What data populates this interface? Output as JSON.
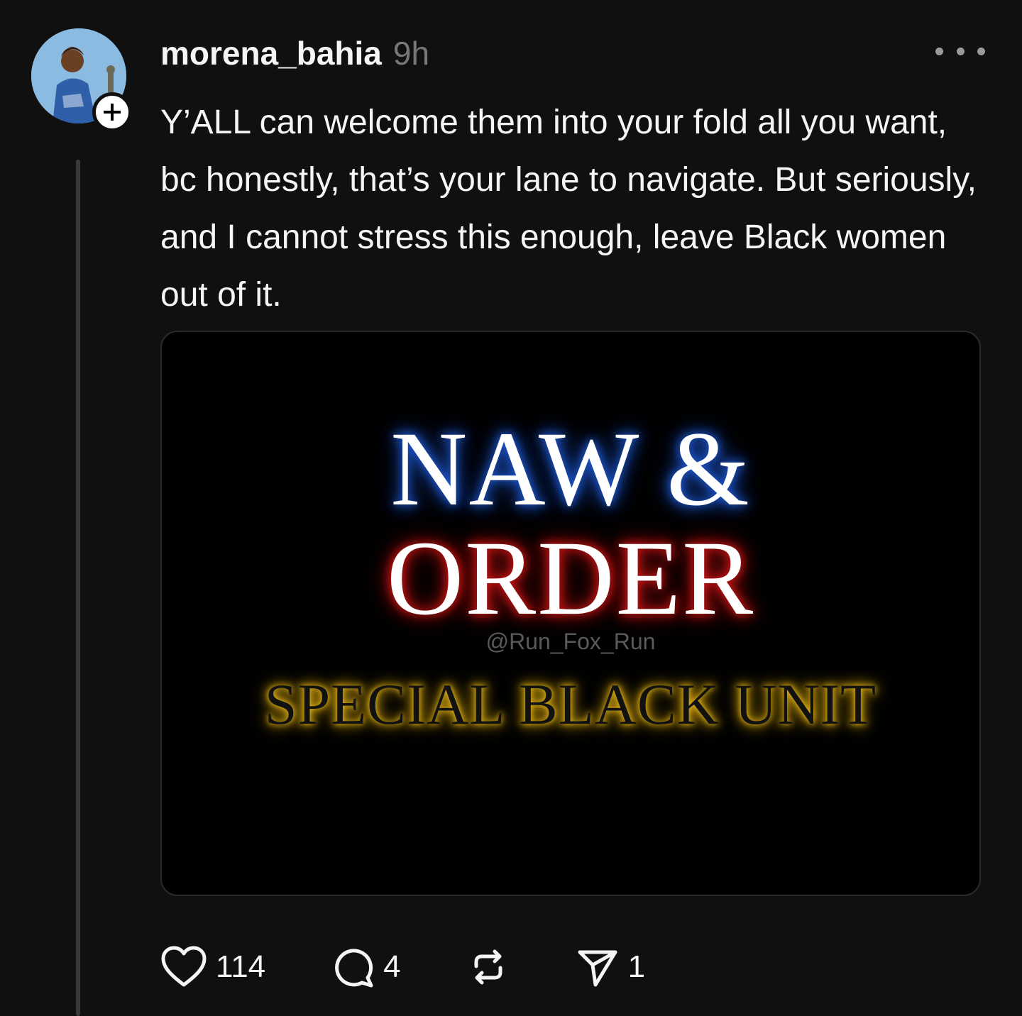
{
  "post": {
    "username": "morena_bahia",
    "time": "9h",
    "text": "Y’ALL can welcome them into your fold all you want, bc honestly, that’s your lane to navigate. But seriously, and I cannot stress this enough, leave Black women out of it.",
    "avatar_icon": "user-avatar",
    "follow_icon": "plus-icon",
    "more_icon": "more-icon"
  },
  "media": {
    "line1": "NAW &",
    "line2": "ORDER",
    "watermark": "@Run_Fox_Run",
    "line3": "SPECIAL BLACK UNIT",
    "colors": {
      "line1_glow": "#1d55c8",
      "line2_glow": "#c81414",
      "line3_glow": "#f1c21b"
    }
  },
  "actions": {
    "likes": "114",
    "replies": "4",
    "shares": "1",
    "icons": [
      "heart-icon",
      "comment-icon",
      "repost-icon",
      "send-icon"
    ]
  }
}
